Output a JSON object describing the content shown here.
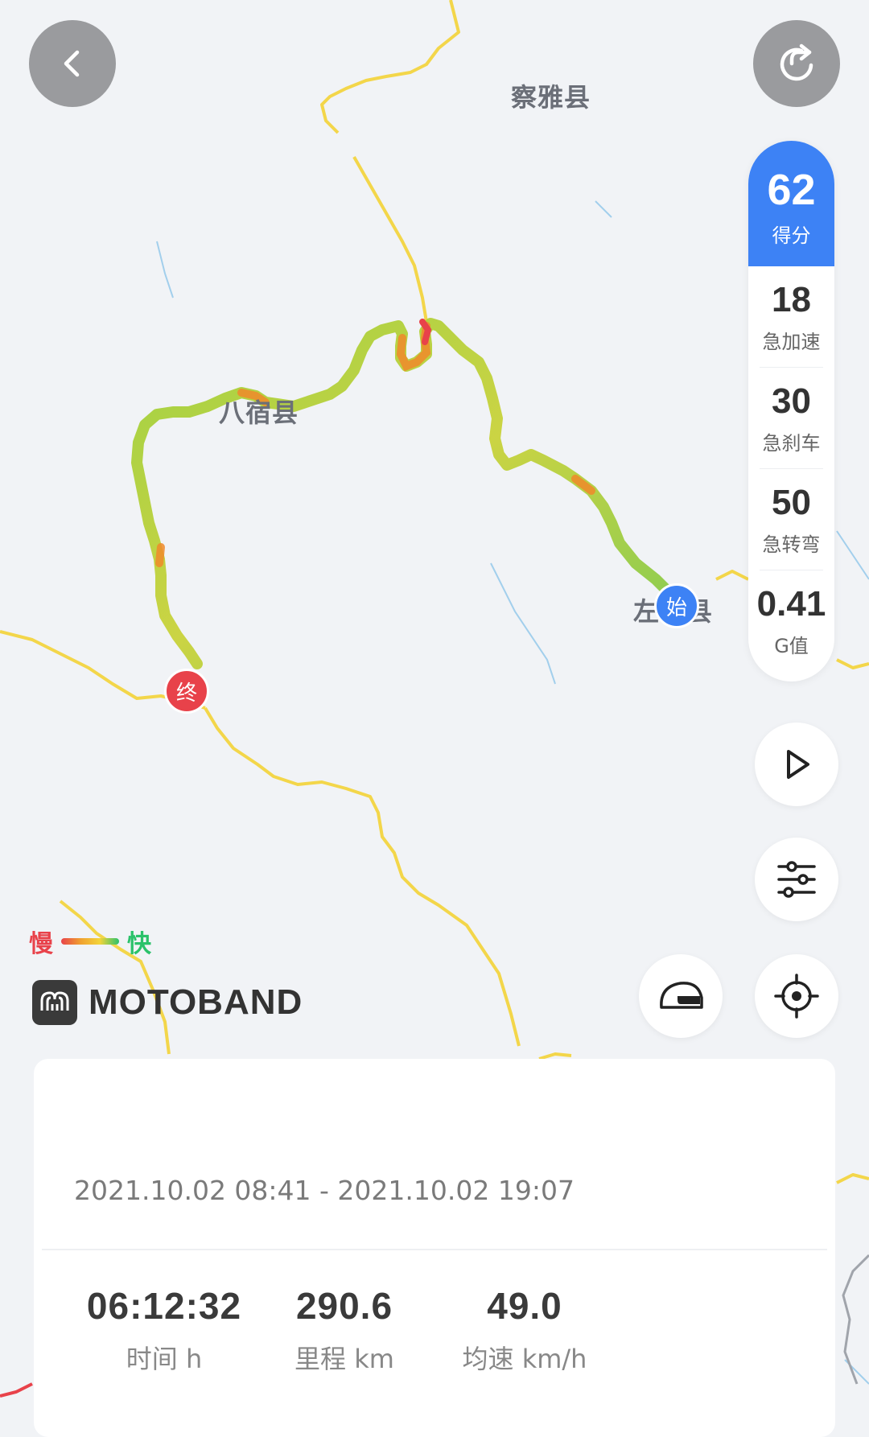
{
  "map": {
    "labels": {
      "chaya": "察雅县",
      "basu": "八宿县",
      "zuogong": "左贡县"
    },
    "start_marker": "始",
    "end_marker": "终",
    "colors": {
      "border": "#f3d64a",
      "river": "#8fc6ea",
      "route_fast": "#2bc26a",
      "route_slow": "#e8424a"
    }
  },
  "buttons": {
    "back_icon": "chevron-left-icon",
    "share_icon": "share-icon",
    "play_icon": "play-icon",
    "filter_icon": "sliders-icon",
    "helmet_icon": "helmet-icon",
    "locate_icon": "locate-icon"
  },
  "score_panel": {
    "score": {
      "value": "62",
      "label": "得分"
    },
    "metrics": [
      {
        "value": "18",
        "label": "急加速"
      },
      {
        "value": "30",
        "label": "急刹车"
      },
      {
        "value": "50",
        "label": "急转弯"
      },
      {
        "value": "0.41",
        "label": "G值"
      }
    ],
    "accent": "#3d82f5"
  },
  "legend": {
    "slow": "慢",
    "fast": "快"
  },
  "brand": {
    "name": "MOTOBAND"
  },
  "trip": {
    "time_range": "2021.10.02 08:41 - 2021.10.02 19:07",
    "stats": [
      {
        "value": "06:12:32",
        "unit": "时间 h"
      },
      {
        "value": "290.6",
        "unit": "里程 km"
      },
      {
        "value": "49.0",
        "unit": "均速 km/h"
      }
    ]
  }
}
